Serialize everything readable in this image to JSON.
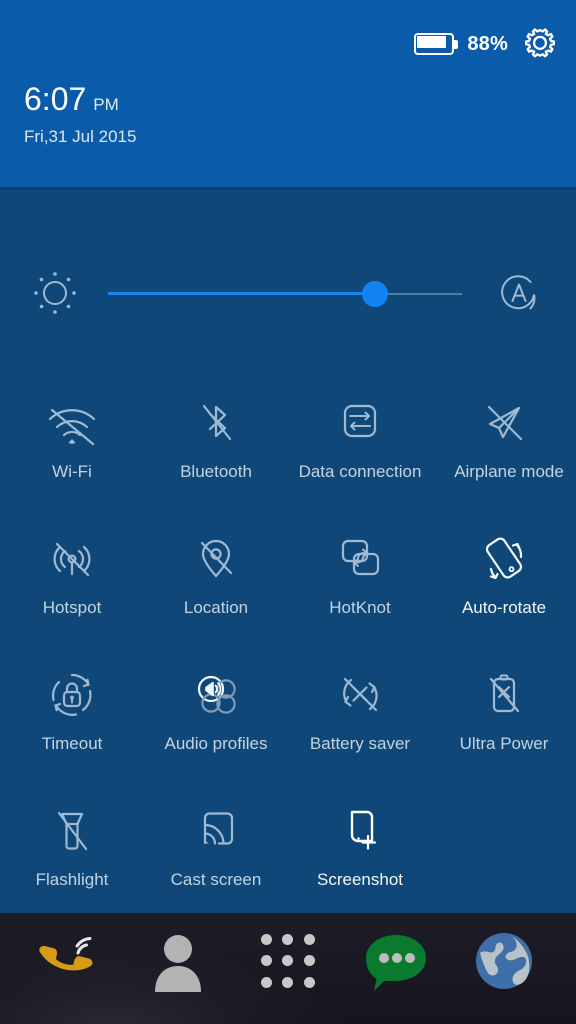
{
  "header": {
    "battery_percent": "88%",
    "battery_level": 88,
    "battery_icon": "battery-icon",
    "settings_icon": "gear-icon",
    "time": "6:07",
    "ampm": "PM",
    "date": "Fri,31 Jul 2015",
    "background_color": "#0b5bab"
  },
  "brightness": {
    "sun_icon": "brightness-sun-icon",
    "auto_icon": "auto-brightness-icon",
    "value_percent": 75,
    "fill_color": "#1a84f0",
    "thumb_color": "#1183f5",
    "track_color": "#4d7ca5"
  },
  "panel": {
    "background_color": "#0f4878"
  },
  "tiles": [
    {
      "label": "Wi-Fi",
      "icon": "wifi-off-icon",
      "state": "off"
    },
    {
      "label": "Bluetooth",
      "icon": "bluetooth-off-icon",
      "state": "off"
    },
    {
      "label": "Data connection",
      "icon": "data-connection-icon",
      "state": "off"
    },
    {
      "label": "Airplane mode",
      "icon": "airplane-mode-off-icon",
      "state": "off"
    },
    {
      "label": "Hotspot",
      "icon": "hotspot-off-icon",
      "state": "off"
    },
    {
      "label": "Location",
      "icon": "location-off-icon",
      "state": "off"
    },
    {
      "label": "HotKnot",
      "icon": "hotknot-icon",
      "state": "off"
    },
    {
      "label": "Auto-rotate",
      "icon": "auto-rotate-icon",
      "state": "on"
    },
    {
      "label": "Timeout",
      "icon": "screen-timeout-icon",
      "state": "off"
    },
    {
      "label": "Audio profiles",
      "icon": "audio-profiles-icon",
      "state": "off"
    },
    {
      "label": "Battery saver",
      "icon": "battery-saver-off-icon",
      "state": "off"
    },
    {
      "label": "Ultra Power",
      "icon": "ultra-power-off-icon",
      "state": "off"
    },
    {
      "label": "Flashlight",
      "icon": "flashlight-off-icon",
      "state": "off"
    },
    {
      "label": "Cast screen",
      "icon": "cast-screen-icon",
      "state": "off"
    },
    {
      "label": "Screenshot",
      "icon": "screenshot-icon",
      "state": "on"
    }
  ],
  "dock": {
    "items": [
      {
        "name": "phone",
        "icon": "phone-icon",
        "color": "#d89b16"
      },
      {
        "name": "contacts",
        "icon": "contacts-icon",
        "color": "#b0b0b0"
      },
      {
        "name": "apps",
        "icon": "app-drawer-icon",
        "color": "#c8c8c8"
      },
      {
        "name": "messages",
        "icon": "message-icon",
        "color": "#0a7a2f"
      },
      {
        "name": "browser",
        "icon": "browser-globe-icon",
        "color": "#3f6fa8"
      }
    ]
  }
}
